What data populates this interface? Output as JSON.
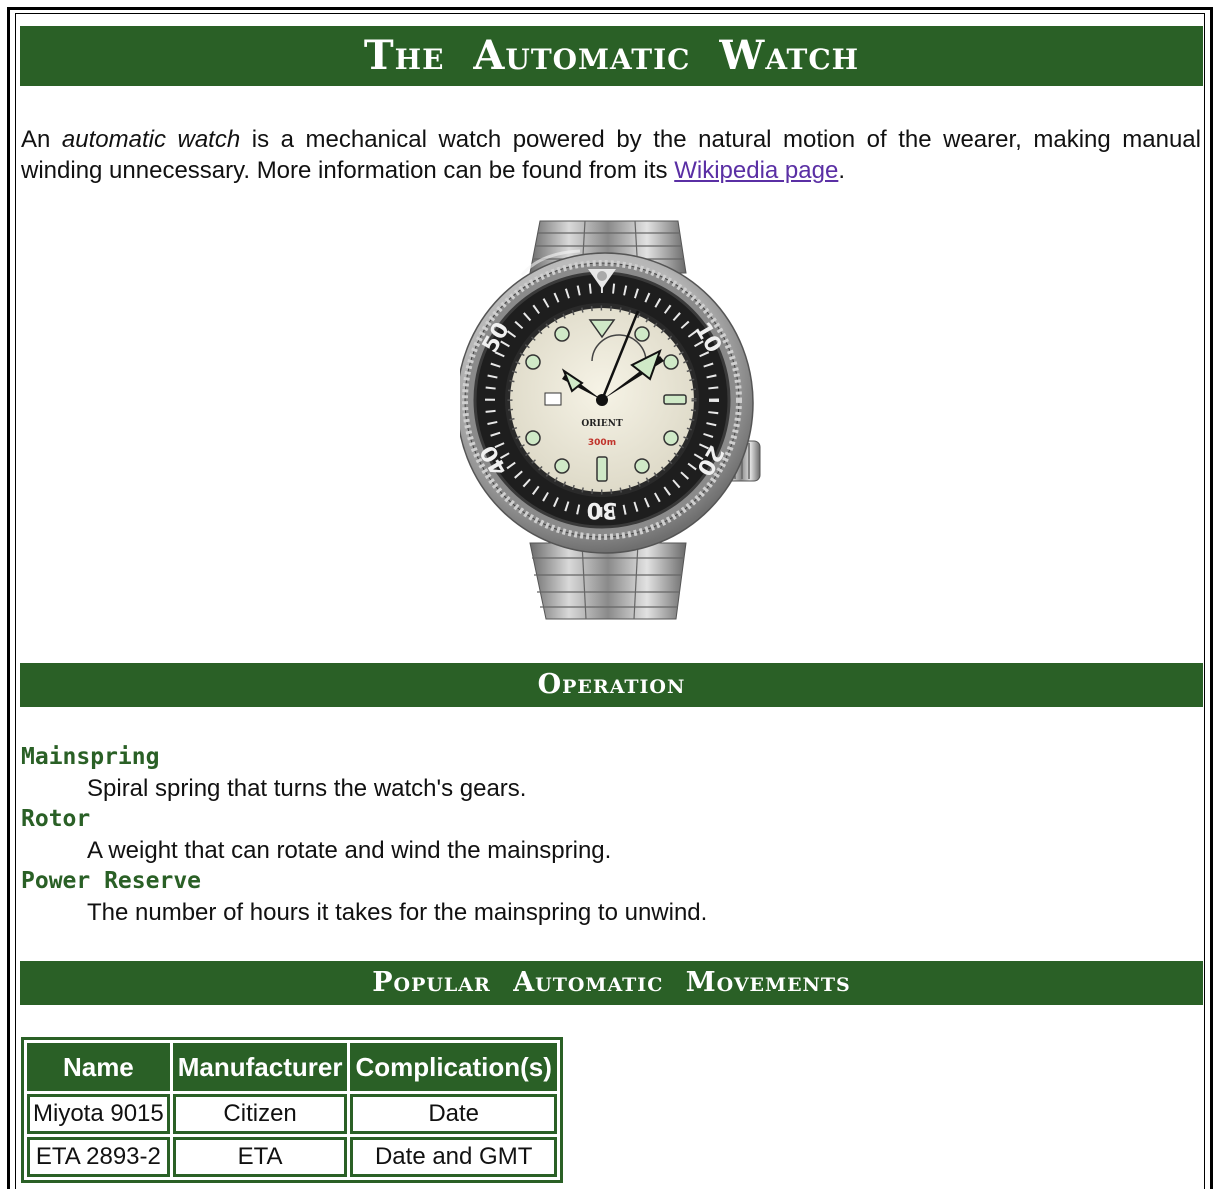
{
  "page": {
    "title": "The Automatic Watch"
  },
  "intro": {
    "prefix": "An ",
    "term": "automatic watch",
    "middle": " is a mechanical watch powered by the natural motion of the wearer, making manual winding unnecessary. More information can be found from its ",
    "link_text": "Wikipedia page",
    "suffix": "."
  },
  "image": {
    "alt": "Orient automatic dive watch",
    "brand": "ORIENT",
    "dial_text": "300m",
    "bezel_numbers": [
      "10",
      "20",
      "30",
      "40",
      "50"
    ]
  },
  "operation": {
    "heading": "Operation",
    "items": [
      {
        "term": "Mainspring",
        "definition": "Spiral spring that turns the watch's gears."
      },
      {
        "term": "Rotor",
        "definition": "A weight that can rotate and wind the mainspring."
      },
      {
        "term": "Power Reserve",
        "definition": "The number of hours it takes for the mainspring to unwind."
      }
    ]
  },
  "movements": {
    "heading": "Popular Automatic Movements",
    "columns": [
      "Name",
      "Manufacturer",
      "Complication(s)"
    ],
    "rows": [
      [
        "Miyota 9015",
        "Citizen",
        "Date"
      ],
      [
        "ETA 2893-2",
        "ETA",
        "Date and GMT"
      ]
    ]
  },
  "colors": {
    "banner": "#2a6026",
    "link": "#5a2fa4",
    "term": "#2a6026"
  }
}
